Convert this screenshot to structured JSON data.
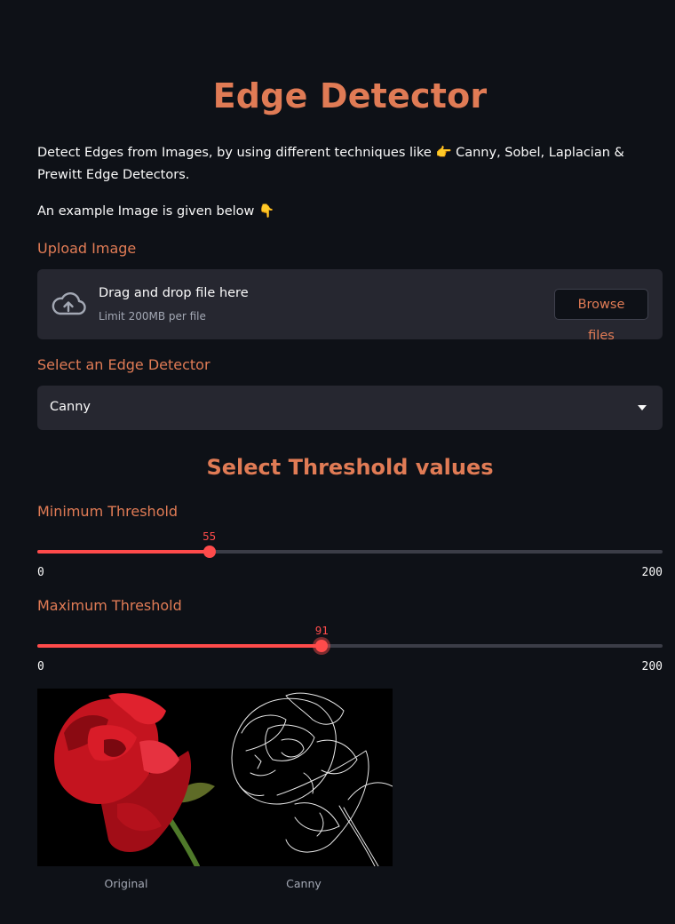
{
  "app": {
    "title": "Edge Detector",
    "description": "Detect Edges from Images, by using different techniques like 👉 Canny, Sobel, Laplacian & Prewitt Edge Detectors.",
    "example_text": "An example Image is given below 👇"
  },
  "uploader": {
    "label": "Upload Image",
    "drop_text": "Drag and drop file here",
    "limit_text": "Limit 200MB per file",
    "browse_label": "Browse files",
    "icon": "cloud-upload-icon"
  },
  "detector": {
    "label": "Select an Edge Detector",
    "selected": "Canny",
    "icon": "chevron-down-icon"
  },
  "threshold": {
    "heading": "Select Threshold values",
    "min_slider": {
      "label": "Minimum Threshold",
      "value": "55",
      "min": "0",
      "max": "200"
    },
    "max_slider": {
      "label": "Maximum Threshold",
      "value": "91",
      "min": "0",
      "max": "200"
    }
  },
  "images": [
    {
      "caption": "Original"
    },
    {
      "caption": "Canny"
    }
  ],
  "colors": {
    "accent": "#e07b55",
    "slider": "#ff4b4b",
    "background": "#0e1117",
    "panel": "#262730"
  }
}
